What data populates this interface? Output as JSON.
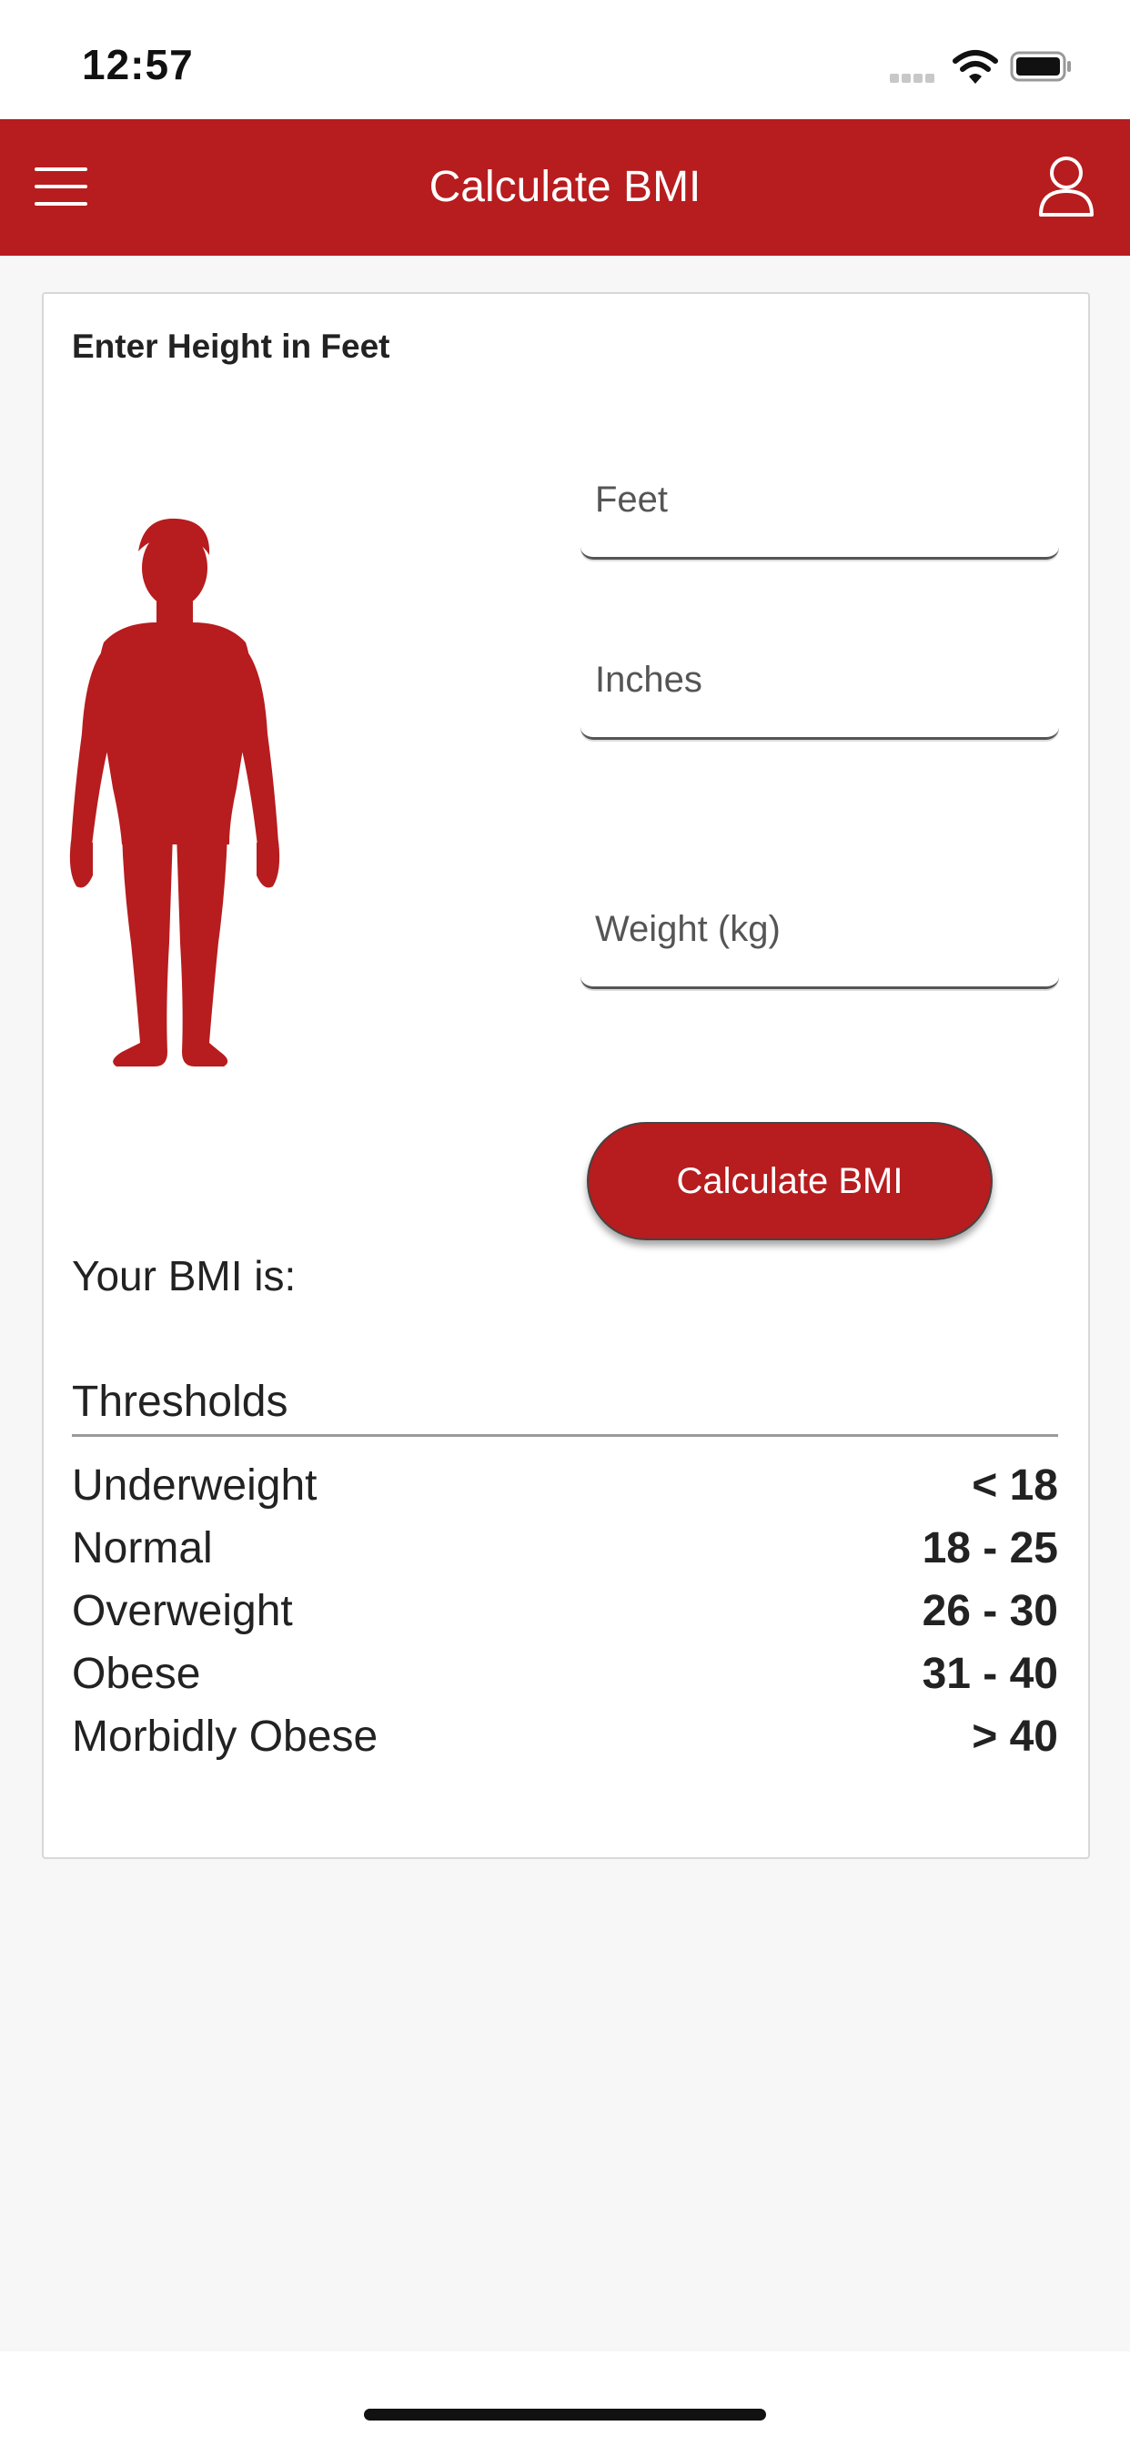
{
  "status_bar": {
    "time": "12:57"
  },
  "header": {
    "title": "Calculate BMI",
    "menu_icon": "hamburger-menu-icon",
    "user_icon": "user-profile-icon"
  },
  "card": {
    "label": "Enter Height in Feet",
    "fields": {
      "feet_placeholder": "Feet",
      "inches_placeholder": "Inches",
      "weight_placeholder": "Weight (kg)"
    },
    "calculate_button": "Calculate BMI",
    "result_label": "Your BMI is:",
    "thresholds": {
      "title": "Thresholds",
      "rows": [
        {
          "label": "Underweight",
          "value": "< 18"
        },
        {
          "label": "Normal",
          "value": "18 - 25"
        },
        {
          "label": "Overweight",
          "value": "26 - 30"
        },
        {
          "label": "Obese",
          "value": "31 - 40"
        },
        {
          "label": "Morbidly Obese",
          "value": "> 40"
        }
      ]
    }
  },
  "colors": {
    "brand": "#b71c1e",
    "background": "#f7f7f7"
  }
}
